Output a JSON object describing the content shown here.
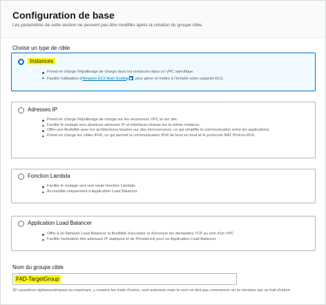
{
  "section": {
    "title": "Configuration de base",
    "description": "Les paramètres de cette section ne peuvent pas être modifiés après la création du groupe cible."
  },
  "target_type": {
    "label": "Choisir un type de cible",
    "options": [
      {
        "title": "Instances",
        "selected": true,
        "bullets": [
          "Prend en charge l'équilibrage de charge dans les instances dans un VPC spécifique.",
          "Facilite l'utilisation d'"
        ],
        "link_text": "Amazon EC2 Auto Scaling",
        "link_suffix": "pour gérer et mettre à l'échelle votre capacité EC2."
      },
      {
        "title": "Adresses IP",
        "selected": false,
        "bullets": [
          "Prend en charge l'équilibrage de charge sur les ressources VPC et sur site.",
          "Facilite le routage vers plusieurs adresses IP et interfaces réseau sur la même instance.",
          "Offre une flexibilité avec les architectures basées sur des microservices, ce qui simplifie la communication entre les applications.",
          "Prend en charge les cibles IPv6, ce qui permet la communication IPv6 de bout en bout et le protocole NAT IPv4-to-IPv6."
        ]
      },
      {
        "title": "Fonction Lambda",
        "selected": false,
        "bullets": [
          "Facilite le routage vers une seule fonction Lambda.",
          "Accessible uniquement à Application Load Balancer."
        ]
      },
      {
        "title": "Application Load Balancer",
        "selected": false,
        "bullets": [
          "Offre à un Network Load Balancer la flexibilité d'accepter et d'envoyer les demandes TCP au sein d'un VPC",
          "Facilite l'activation des adresses IP statiques et de PrivateLink pour un Application Load Balancer"
        ]
      }
    ]
  },
  "target_group_name": {
    "label": "Nom du groupe cible",
    "value": "FAD-TargetGroup",
    "constraint": "32 caractères alphanumériques au maximum, y compris les traits d'union, sont autorisés mais le nom ne doit pas commencer ou se terminer par un trait d'union."
  },
  "colors": {
    "accent": "#0073bb",
    "highlight": "#fbf507",
    "selected_bg": "#f1faff"
  }
}
